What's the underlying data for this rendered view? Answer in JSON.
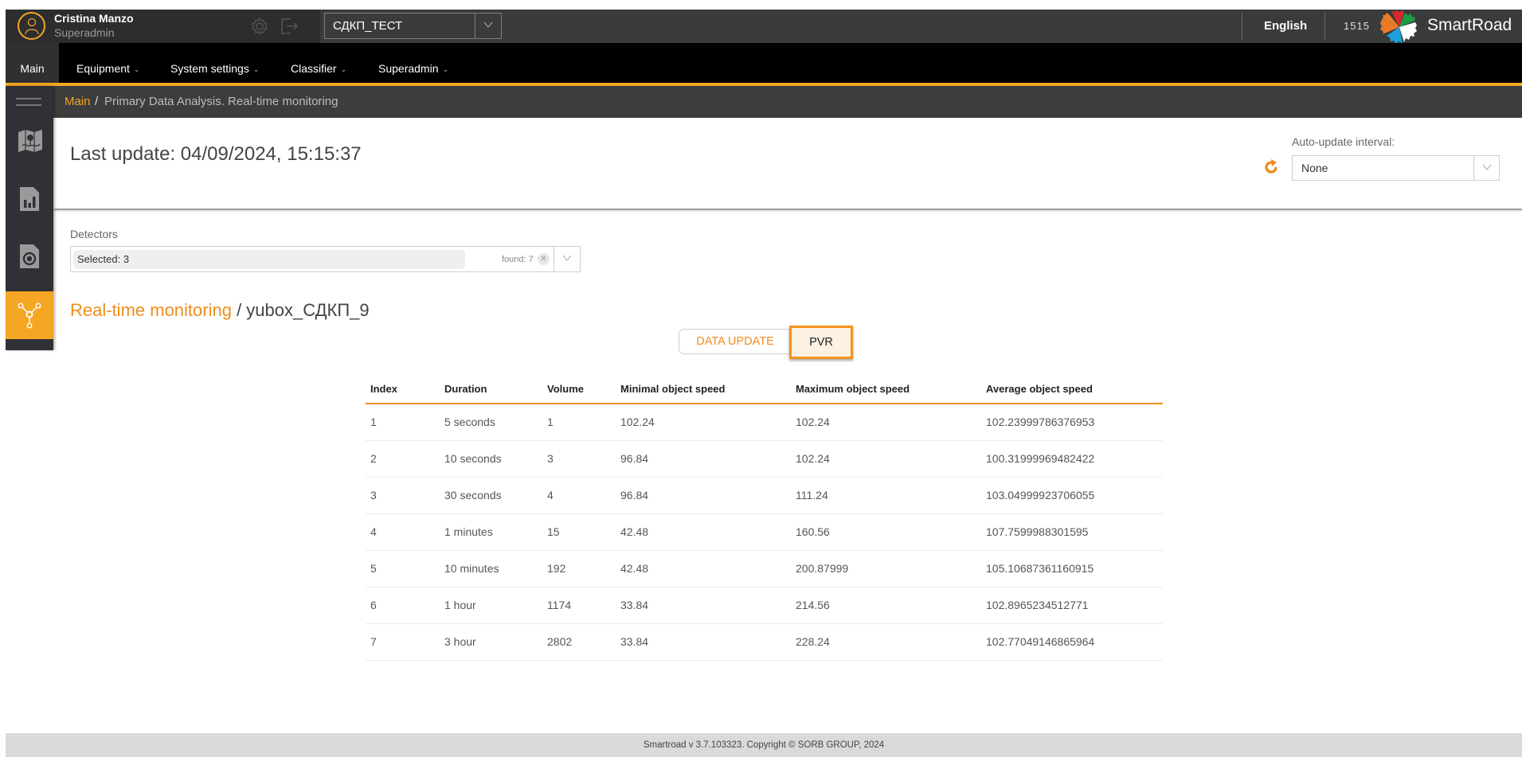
{
  "header": {
    "user_name": "Cristina Manzo",
    "user_role": "Superadmin",
    "site_select": "СДКП_ТЕСТ",
    "language": "English",
    "clock": "1515",
    "brand": "SmartRoad"
  },
  "nav": {
    "items": [
      {
        "label": "Main",
        "active": true,
        "has_menu": false
      },
      {
        "label": "Equipment",
        "active": false,
        "has_menu": true
      },
      {
        "label": "System settings",
        "active": false,
        "has_menu": true
      },
      {
        "label": "Classifier",
        "active": false,
        "has_menu": true
      },
      {
        "label": "Superadmin",
        "active": false,
        "has_menu": true
      }
    ]
  },
  "breadcrumb": {
    "root": "Main",
    "separator": "/",
    "current": "Primary Data Analysis. Real-time monitoring"
  },
  "sidebar": {
    "items": [
      {
        "icon": "map-icon",
        "active": false
      },
      {
        "icon": "report-chart-icon",
        "active": false
      },
      {
        "icon": "detector-camera-icon",
        "active": false
      },
      {
        "icon": "network-nodes-icon",
        "active": true
      }
    ]
  },
  "content": {
    "last_update": "Last update: 04/09/2024, 15:15:37",
    "auto_update_label": "Auto-update interval:",
    "auto_update_value": "None",
    "detectors_label": "Detectors",
    "detectors_selected": "Selected: 3",
    "detectors_found": "found: 7",
    "title_link": "Real-time monitoring",
    "title_rest": " / yubox_СДКП_9",
    "buttons": {
      "data_update": "DATA UPDATE",
      "pvr": "PVR"
    }
  },
  "table": {
    "columns": [
      "Index",
      "Duration",
      "Volume",
      "Minimal object speed",
      "Maximum object speed",
      "Average object speed"
    ],
    "rows": [
      [
        "1",
        "5 seconds",
        "1",
        "102.24",
        "102.24",
        "102.23999786376953"
      ],
      [
        "2",
        "10 seconds",
        "3",
        "96.84",
        "102.24",
        "100.31999969482422"
      ],
      [
        "3",
        "30 seconds",
        "4",
        "96.84",
        "111.24",
        "103.04999923706055"
      ],
      [
        "4",
        "1 minutes",
        "15",
        "42.48",
        "160.56",
        "107.7599988301595"
      ],
      [
        "5",
        "10 minutes",
        "192",
        "42.48",
        "200.87999",
        "105.10687361160915"
      ],
      [
        "6",
        "1 hour",
        "1174",
        "33.84",
        "214.56",
        "102.8965234512771"
      ],
      [
        "7",
        "3 hour",
        "2802",
        "33.84",
        "228.24",
        "102.77049146865964"
      ]
    ]
  },
  "footer": {
    "text": "Smartroad v 3.7.103323. Copyright © SORB GROUP, 2024"
  },
  "colors": {
    "accent": "#f5a623",
    "accent_text": "#f08c1e",
    "header_bg": "#3a3b3b",
    "nav_bg": "#000000",
    "sidebar_bg": "#303136"
  }
}
